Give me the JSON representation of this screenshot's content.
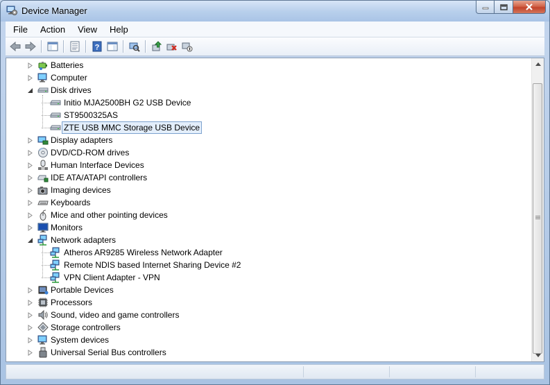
{
  "window": {
    "title": "Device Manager"
  },
  "menu": [
    "File",
    "Action",
    "View",
    "Help"
  ],
  "toolbar": [
    {
      "name": "back-button",
      "icon": "back-arrow-icon"
    },
    {
      "name": "forward-button",
      "icon": "forward-arrow-icon"
    },
    {
      "name": "show-hide-console-tree-button",
      "icon": "console-tree-icon"
    },
    {
      "name": "properties-button",
      "icon": "properties-icon"
    },
    {
      "name": "help-button",
      "icon": "help-icon"
    },
    {
      "name": "show-action-pane-button",
      "icon": "action-pane-icon"
    },
    {
      "name": "scan-hardware-button",
      "icon": "scan-hardware-icon"
    },
    {
      "name": "update-driver-button",
      "icon": "update-driver-icon"
    },
    {
      "name": "uninstall-button",
      "icon": "uninstall-icon"
    },
    {
      "name": "disable-button",
      "icon": "disable-icon"
    }
  ],
  "tree": [
    {
      "label": "Batteries",
      "level": 0,
      "expander": "collapsed",
      "icon": "battery-icon"
    },
    {
      "label": "Computer",
      "level": 0,
      "expander": "collapsed",
      "icon": "computer-icon"
    },
    {
      "label": "Disk drives",
      "level": 0,
      "expander": "expanded",
      "icon": "disk-drive-icon"
    },
    {
      "label": "Initio MJA2500BH G2 USB Device",
      "level": 1,
      "icon": "disk-drive-icon"
    },
    {
      "label": "ST9500325AS",
      "level": 1,
      "icon": "disk-drive-icon"
    },
    {
      "label": "ZTE USB MMC Storage USB Device",
      "level": 1,
      "icon": "disk-drive-icon",
      "selected": true
    },
    {
      "label": "Display adapters",
      "level": 0,
      "expander": "collapsed",
      "icon": "display-adapter-icon"
    },
    {
      "label": "DVD/CD-ROM drives",
      "level": 0,
      "expander": "collapsed",
      "icon": "dvd-drive-icon"
    },
    {
      "label": "Human Interface Devices",
      "level": 0,
      "expander": "collapsed",
      "icon": "hid-icon"
    },
    {
      "label": "IDE ATA/ATAPI controllers",
      "level": 0,
      "expander": "collapsed",
      "icon": "ide-controller-icon"
    },
    {
      "label": "Imaging devices",
      "level": 0,
      "expander": "collapsed",
      "icon": "camera-icon"
    },
    {
      "label": "Keyboards",
      "level": 0,
      "expander": "collapsed",
      "icon": "keyboard-icon"
    },
    {
      "label": "Mice and other pointing devices",
      "level": 0,
      "expander": "collapsed",
      "icon": "mouse-icon"
    },
    {
      "label": "Monitors",
      "level": 0,
      "expander": "collapsed",
      "icon": "monitor-icon"
    },
    {
      "label": "Network adapters",
      "level": 0,
      "expander": "expanded",
      "icon": "network-adapter-icon"
    },
    {
      "label": "Atheros AR9285 Wireless Network Adapter",
      "level": 1,
      "icon": "network-adapter-icon"
    },
    {
      "label": "Remote NDIS based Internet Sharing Device #2",
      "level": 1,
      "icon": "network-adapter-icon"
    },
    {
      "label": "VPN Client Adapter - VPN",
      "level": 1,
      "icon": "network-adapter-icon"
    },
    {
      "label": "Portable Devices",
      "level": 0,
      "expander": "collapsed",
      "icon": "portable-device-icon"
    },
    {
      "label": "Processors",
      "level": 0,
      "expander": "collapsed",
      "icon": "processor-icon"
    },
    {
      "label": "Sound, video and game controllers",
      "level": 0,
      "expander": "collapsed",
      "icon": "speaker-icon"
    },
    {
      "label": "Storage controllers",
      "level": 0,
      "expander": "collapsed",
      "icon": "storage-controller-icon"
    },
    {
      "label": "System devices",
      "level": 0,
      "expander": "collapsed",
      "icon": "system-device-icon"
    },
    {
      "label": "Universal Serial Bus controllers",
      "level": 0,
      "expander": "collapsed",
      "icon": "usb-icon"
    }
  ]
}
